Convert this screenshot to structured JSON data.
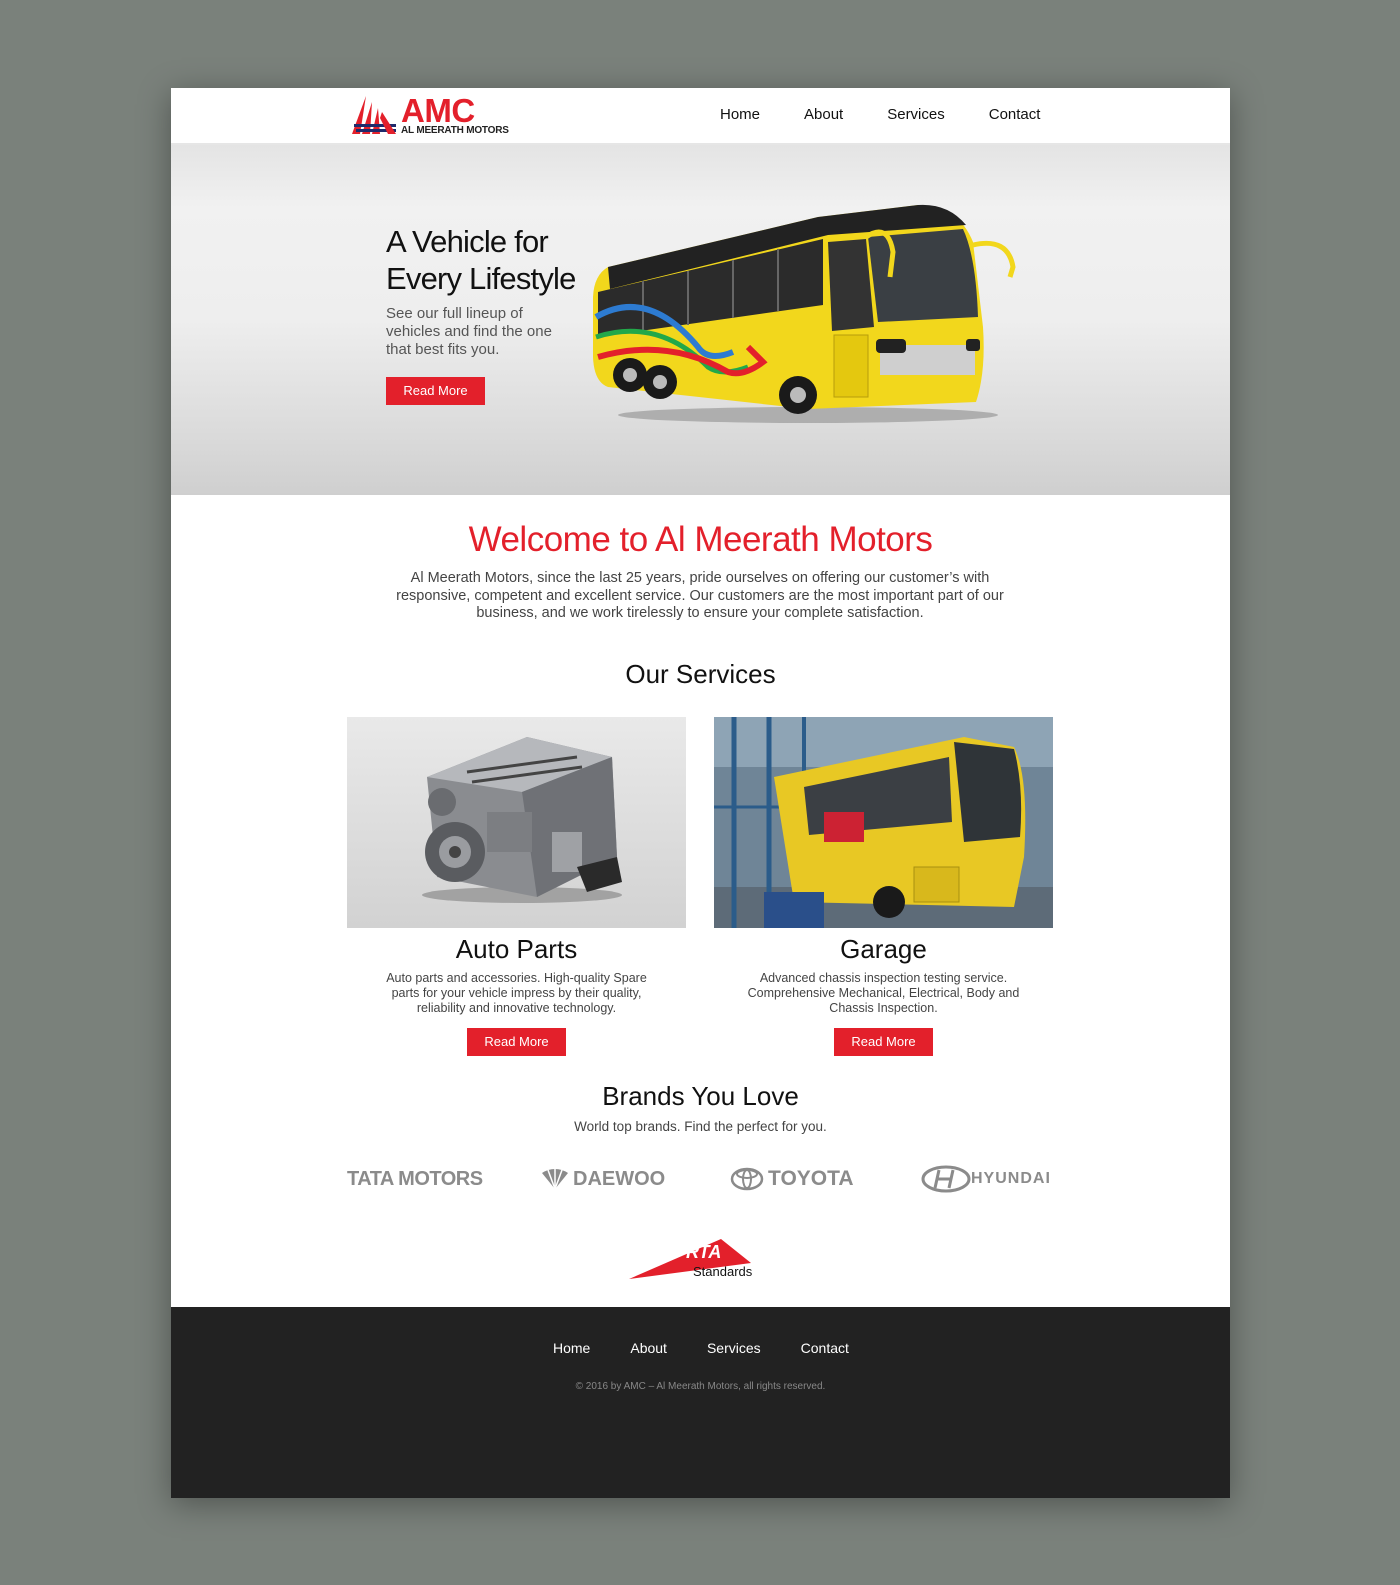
{
  "header": {
    "logo_text": "AMC",
    "logo_subtext": "AL MEERATH MOTORS",
    "nav": [
      "Home",
      "About",
      "Services",
      "Contact"
    ]
  },
  "hero": {
    "title": "A Vehicle for Every Lifestyle",
    "subtitle": "See our full lineup of vehicles and find the one that best fits you.",
    "button_label": "Read More"
  },
  "welcome": {
    "title": "Welcome to Al Meerath Motors",
    "text": "Al Meerath Motors, since the last 25 years, pride ourselves on offering our customer’s with responsive, competent and excellent service. Our customers are the most important part of our business, and we work tirelessly to ensure your complete satisfaction."
  },
  "services": {
    "title": "Our Services",
    "cards": [
      {
        "title": "Auto Parts",
        "text": "Auto parts and accessories. High-quality Spare parts for your vehicle impress by their quality, reliability and innovative technology.",
        "button_label": "Read More"
      },
      {
        "title": "Garage",
        "text": "Advanced chassis inspection testing service. Comprehensive Mechanical, Electrical, Body and Chassis Inspection.",
        "button_label": "Read More"
      }
    ]
  },
  "brands": {
    "title": "Brands You Love",
    "subtitle": "World top brands. Find the perfect for you.",
    "logos": [
      "TATA MOTORS",
      "DAEWOO",
      "TOYOTA",
      "HYUNDAI"
    ],
    "rta_text": "RTA",
    "rta_sub": "Standards"
  },
  "footer": {
    "nav": [
      "Home",
      "About",
      "Services",
      "Contact"
    ],
    "copyright": "© 2016 by AMC – Al Meerath Motors, all rights reserved."
  },
  "colors": {
    "accent": "#e3202b",
    "footer_bg": "#222222",
    "backdrop": "#7a817b"
  }
}
